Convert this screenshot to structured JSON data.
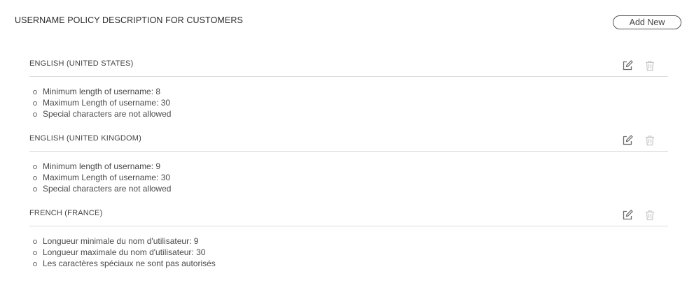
{
  "header": {
    "title": "USERNAME POLICY DESCRIPTION FOR CUSTOMERS",
    "add_label": "Add New"
  },
  "sections": [
    {
      "title": "ENGLISH (UNITED STATES)",
      "items": [
        "Minimum length of username: 8",
        "Maximum Length of username: 30",
        "Special characters are not allowed"
      ]
    },
    {
      "title": "ENGLISH (UNITED KINGDOM)",
      "items": [
        "Minimum length of username: 9",
        "Maximum Length of username: 30",
        "Special characters are not allowed"
      ]
    },
    {
      "title": "FRENCH (FRANCE)",
      "items": [
        "Longueur minimale du nom d'utilisateur: 9",
        "Longueur maximale du nom d'utilisateur: 30",
        "Les caractères spéciaux ne sont pas autorisés"
      ]
    }
  ],
  "icons": {
    "edit": "edit-icon",
    "delete": "trash-icon"
  },
  "colors": {
    "icon": "#6b6b6b",
    "icon_disabled": "#c8c8c8",
    "divider": "#dcdcdc"
  }
}
